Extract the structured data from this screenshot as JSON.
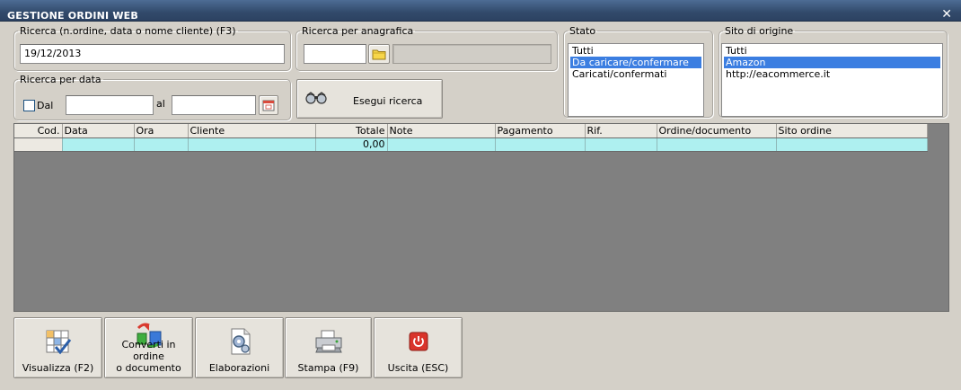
{
  "window": {
    "title": "GESTIONE ORDINI WEB",
    "close_glyph": "✕"
  },
  "search": {
    "legend": "Ricerca (n.ordine, data o nome cliente) (F3)",
    "value": "19/12/2013"
  },
  "anagrafica": {
    "legend": "Ricerca per anagrafica",
    "value": ""
  },
  "date_search": {
    "legend": "Ricerca per data",
    "from_label": "Dal",
    "from_checked": false,
    "from_value": "",
    "to_label": "al",
    "to_value": "",
    "calendar_icon": "calendar-icon"
  },
  "run_search": {
    "label": "Esegui ricerca",
    "icon": "binoculars-icon"
  },
  "stato": {
    "legend": "Stato",
    "options": [
      "Tutti",
      "Da caricare/confermare",
      "Caricati/confermati"
    ],
    "selected": 1
  },
  "sito": {
    "legend": "Sito di origine",
    "options": [
      "Tutti",
      "Amazon",
      "http://eacommerce.it"
    ],
    "selected": 1
  },
  "grid": {
    "columns": [
      "Cod.",
      "Data",
      "Ora",
      "Cliente",
      "Totale",
      "Note",
      "Pagamento",
      "Rif.",
      "Ordine/documento",
      "Sito ordine"
    ],
    "rows": [
      [
        "",
        "",
        "",
        "",
        "0,00",
        "",
        "",
        "",
        "",
        ""
      ]
    ]
  },
  "actions": [
    {
      "name": "visualizza-button",
      "label": "Visualizza (F2)",
      "icon": "view-grid-icon"
    },
    {
      "name": "converti-button",
      "label": "Converti in ordine o documento",
      "label_line1": "Converti in ordine",
      "label_line2": "o documento",
      "icon": "convert-icon"
    },
    {
      "name": "elaborazioni-button",
      "label": "Elaborazioni",
      "icon": "gear-document-icon"
    },
    {
      "name": "stampa-button",
      "label": "Stampa (F9)",
      "icon": "printer-icon"
    },
    {
      "name": "uscita-button",
      "label": "Uscita (ESC)",
      "icon": "power-icon"
    }
  ],
  "colors": {
    "titlebar": "#324a6b",
    "selection": "#3b7ee1",
    "grid_row": "#aef0f0",
    "grid_bg": "#808080",
    "exit_red": "#d9342b"
  }
}
